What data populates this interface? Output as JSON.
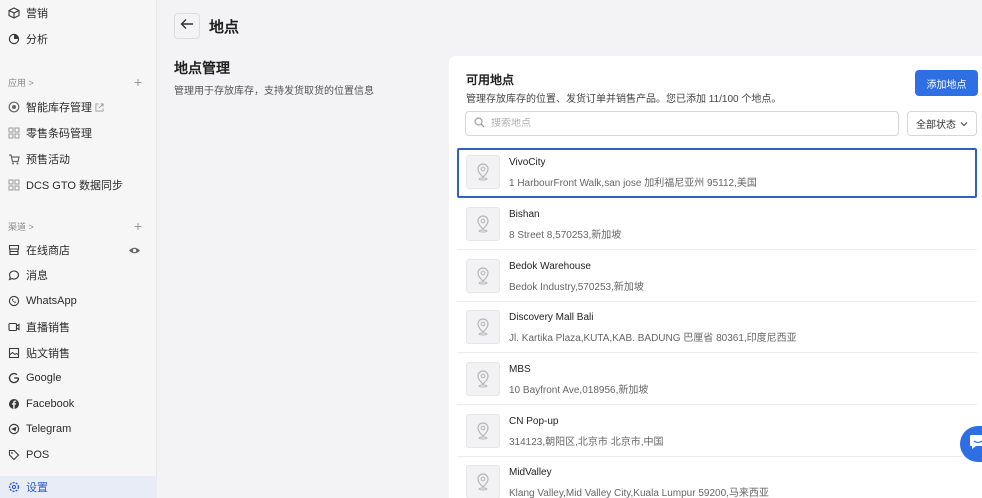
{
  "sidebar": {
    "top_items": [
      {
        "label": "营销",
        "icon": "marketing-icon"
      },
      {
        "label": "分析",
        "icon": "analytics-icon"
      }
    ],
    "apps_group": {
      "label": "应用 >",
      "items": [
        {
          "label": "智能库存管理",
          "icon": "inventory-icon"
        },
        {
          "label": "零售条码管理",
          "icon": "barcode-icon"
        },
        {
          "label": "预售活动",
          "icon": "presale-icon"
        },
        {
          "label": "DCS GTO 数据同步",
          "icon": "sync-icon"
        }
      ]
    },
    "channels_group": {
      "label": "渠道 >",
      "items": [
        {
          "label": "在线商店",
          "icon": "store-icon"
        },
        {
          "label": "消息",
          "icon": "message-icon"
        },
        {
          "label": "WhatsApp",
          "icon": "whatsapp-icon"
        },
        {
          "label": "直播销售",
          "icon": "live-icon"
        },
        {
          "label": "贴文销售",
          "icon": "post-icon"
        },
        {
          "label": "Google",
          "icon": "google-icon"
        },
        {
          "label": "Facebook",
          "icon": "facebook-icon"
        },
        {
          "label": "Telegram",
          "icon": "telegram-icon"
        },
        {
          "label": "POS",
          "icon": "pos-icon"
        }
      ]
    },
    "settings": {
      "label": "设置",
      "icon": "gear-icon"
    }
  },
  "header": {
    "title": "地点"
  },
  "section": {
    "title": "地点管理",
    "description": "管理用于存放库存，支持发货取货的位置信息"
  },
  "card": {
    "title": "可用地点",
    "description": "管理存放库存的位置、发货订单并销售产品。您已添加 11/100 个地点。",
    "add_button": "添加地点",
    "search_placeholder": "搜索地点",
    "status_filter": "全部状态"
  },
  "locations": [
    {
      "name": "VivoCity",
      "address": "1 HarbourFront Walk,san jose 加利福尼亚州 95112,美国",
      "selected": true
    },
    {
      "name": "Bishan",
      "address": "8 Street 8,570253,新加坡"
    },
    {
      "name": "Bedok Warehouse",
      "address": "Bedok Industry,570253,新加坡"
    },
    {
      "name": "Discovery Mall Bali",
      "address": "Jl. Kartika Plaza,KUTA,KAB. BADUNG 巴厘省 80361,印度尼西亚"
    },
    {
      "name": "MBS",
      "address": "10 Bayfront Ave,018956,新加坡"
    },
    {
      "name": "CN Pop-up",
      "address": "314123,朝阳区,北京市 北京市,中国"
    },
    {
      "name": "MidValley",
      "address": "Klang Valley,Mid Valley City,Kuala Lumpur 59200,马来西亚"
    }
  ],
  "colors": {
    "accent": "#2f6fe4",
    "selected_border": "#2f5fc9"
  }
}
